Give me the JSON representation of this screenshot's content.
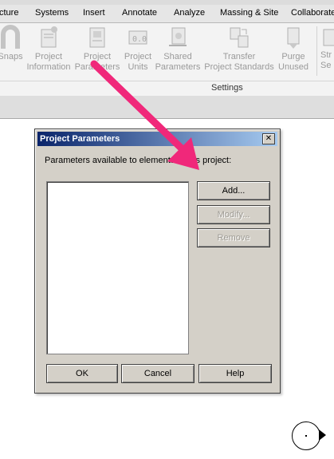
{
  "ribbon": {
    "tabs": [
      "cture",
      "Systems",
      "Insert",
      "Annotate",
      "Analyze",
      "Massing & Site",
      "Collaborate"
    ],
    "buttons": [
      {
        "label_line1": "Snaps",
        "label_line2": "",
        "icon": "snaps-icon"
      },
      {
        "label_line1": "Project",
        "label_line2": "Information",
        "icon": "project-information-icon"
      },
      {
        "label_line1": "Project",
        "label_line2": "Parameters",
        "icon": "project-parameters-icon"
      },
      {
        "label_line1": "Project",
        "label_line2": "Units",
        "icon": "project-units-icon"
      },
      {
        "label_line1": "Shared",
        "label_line2": "Parameters",
        "icon": "shared-parameters-icon"
      },
      {
        "label_line1": "Transfer",
        "label_line2": "Project Standards",
        "icon": "transfer-standards-icon"
      },
      {
        "label_line1": "Purge",
        "label_line2": "Unused",
        "icon": "purge-unused-icon"
      },
      {
        "label_line1": "Str",
        "label_line2": "Se",
        "icon": "structural-settings-icon"
      }
    ],
    "panel_label": "Settings"
  },
  "dialog": {
    "title": "Project Parameters",
    "close_glyph": "✕",
    "label": "Parameters available to elements in this project:",
    "parameters": [],
    "buttons": {
      "add": "Add...",
      "modify": "Modify...",
      "remove": "Remove",
      "ok": "OK",
      "cancel": "Cancel",
      "help": "Help"
    }
  },
  "colors": {
    "annotation_arrow": "#f0287a",
    "dialog_face": "#d4d0c8",
    "title_start": "#0a246a",
    "title_end": "#a6caf0"
  }
}
